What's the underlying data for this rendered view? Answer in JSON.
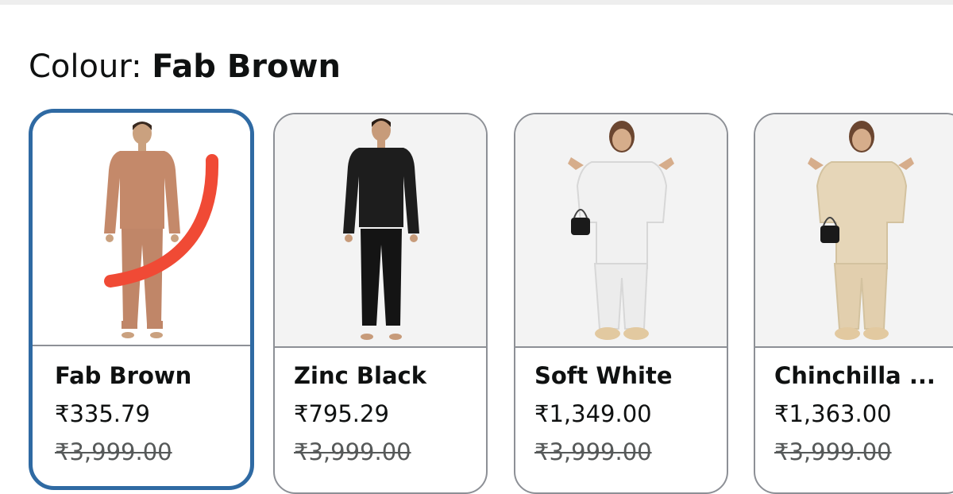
{
  "colour_selector": {
    "label": "Colour:",
    "selected_value": "Fab Brown"
  },
  "swatches": [
    {
      "name": "Fab Brown",
      "price": "₹335.79",
      "mrp": "₹3,999.00",
      "color": "#c4896a",
      "selected": true
    },
    {
      "name": "Zinc Black",
      "price": "₹795.29",
      "mrp": "₹3,999.00",
      "color": "#1d1d1d",
      "selected": false
    },
    {
      "name": "Soft White",
      "price": "₹1,349.00",
      "mrp": "₹3,999.00",
      "color": "#f1f1f1",
      "selected": false
    },
    {
      "name": "Chinchilla ...",
      "price": "₹1,363.00",
      "mrp": "₹3,999.00",
      "color": "#e6d6b8",
      "selected": false
    }
  ],
  "colors": {
    "selected_border": "#2f6aa3",
    "card_border": "#8d9096",
    "annotation_mark": "#f04a35"
  }
}
